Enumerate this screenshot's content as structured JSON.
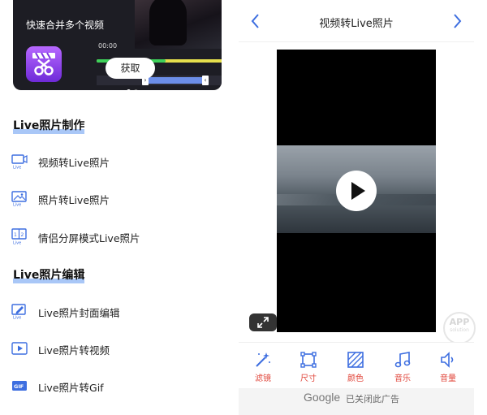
{
  "left": {
    "banner": {
      "subtitle": "快速合并多个视频",
      "time_label": "00:00",
      "get_button": "获取"
    },
    "sections": [
      {
        "title": "Live照片制作",
        "items": [
          {
            "label": "视频转Live照片",
            "icon": "video-to-live-icon"
          },
          {
            "label": "照片转Live照片",
            "icon": "photo-to-live-icon"
          },
          {
            "label": "情侣分屏模式Live照片",
            "icon": "split-screen-live-icon"
          }
        ]
      },
      {
        "title": "Live照片编辑",
        "items": [
          {
            "label": "Live照片封面编辑",
            "icon": "cover-edit-icon"
          },
          {
            "label": "Live照片转视频",
            "icon": "live-to-video-icon"
          },
          {
            "label": "Live照片转Gif",
            "icon": "gif-icon"
          }
        ]
      }
    ]
  },
  "right": {
    "title": "视频转Live照片",
    "toolbar": [
      {
        "label": "滤镜",
        "icon": "magic-wand-icon"
      },
      {
        "label": "尺寸",
        "icon": "crop-frame-icon"
      },
      {
        "label": "颜色",
        "icon": "color-hatch-icon"
      },
      {
        "label": "音乐",
        "icon": "music-note-icon"
      },
      {
        "label": "音量",
        "icon": "speaker-icon"
      }
    ],
    "watermark": {
      "main": "APP",
      "sub": "solution"
    },
    "ad": {
      "brand": "Google",
      "text": "已关闭此广告"
    },
    "colors": {
      "accent": "#3d6ee0",
      "tool_label": "#e0453a",
      "highlight": "#a9c7f7"
    }
  }
}
